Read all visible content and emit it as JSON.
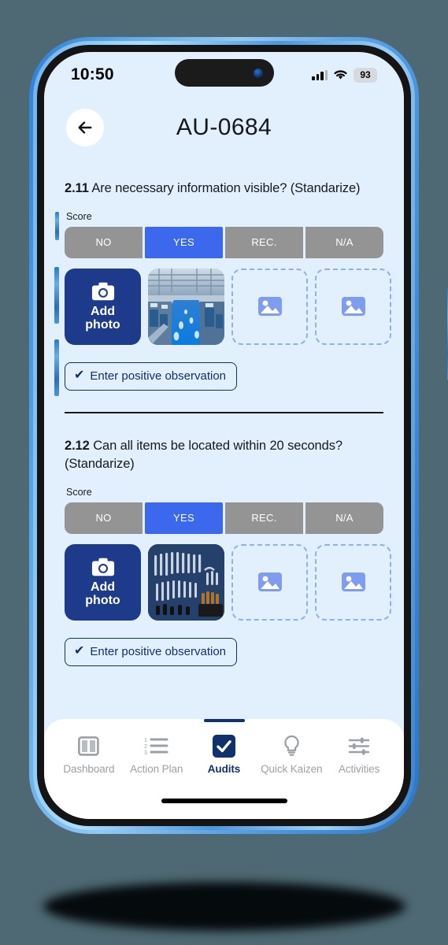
{
  "status_bar": {
    "time": "10:50",
    "battery_level": "93",
    "signal_icon": "cellular-signal-icon",
    "wifi_icon": "wifi-icon"
  },
  "header": {
    "back_icon": "arrow-left-icon",
    "title": "AU-0684"
  },
  "score_options": [
    "NO",
    "YES",
    "REC.",
    "N/A"
  ],
  "labels": {
    "score": "Score",
    "add_photo": "Add\nphoto",
    "add_photo_line1": "Add",
    "add_photo_line2": "photo",
    "observation": "Enter positive observation",
    "check_glyph": "✔"
  },
  "questions": [
    {
      "number": "2.11",
      "text": " Are necessary information visible? (Standarize)",
      "selected_score": "YES",
      "photos": [
        {
          "type": "filled",
          "caption": "industrial-facility-photo"
        },
        {
          "type": "empty"
        },
        {
          "type": "empty"
        }
      ]
    },
    {
      "number": "2.12",
      "text": " Can all items be located within 20 seconds? (Standarize)",
      "selected_score": "YES",
      "photos": [
        {
          "type": "filled",
          "caption": "tool-shadow-board-photo"
        },
        {
          "type": "empty"
        },
        {
          "type": "empty"
        }
      ]
    }
  ],
  "tabbar": {
    "active": "Audits",
    "items": [
      {
        "label": "Dashboard",
        "icon": "dashboard-panels-icon",
        "active": false
      },
      {
        "label": "Action Plan",
        "icon": "numbered-list-icon",
        "active": false
      },
      {
        "label": "Audits",
        "icon": "checkmark-square-icon",
        "active": true
      },
      {
        "label": "Quick Kaizen",
        "icon": "lightbulb-icon",
        "active": false
      },
      {
        "label": "Activities",
        "icon": "sliders-icon",
        "active": false
      }
    ]
  },
  "colors": {
    "background": "#4e6973",
    "screen_bg": "#e2effd",
    "accent_blue": "#3c68ee",
    "navy": "#1e3a8a",
    "segment_gray": "#949494",
    "placeholder_blue": "#8fb0f0"
  }
}
